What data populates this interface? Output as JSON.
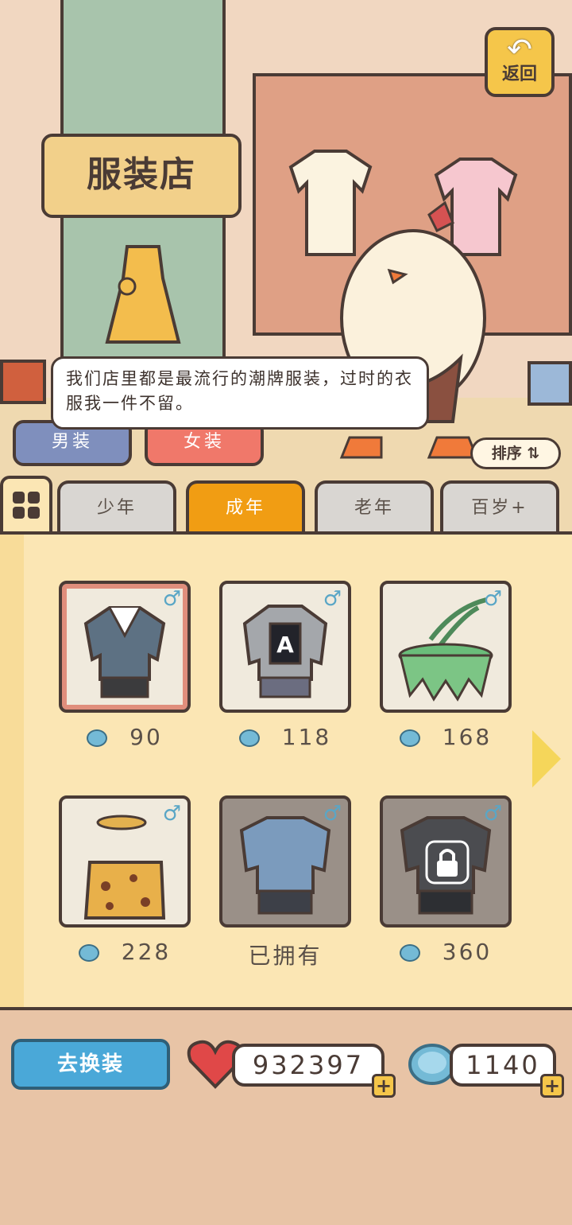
{
  "header": {
    "back_label": "返回",
    "shop_sign": "服装店",
    "speech": "我们店里都是最流行的潮牌服装，过时的衣服我一件不留。"
  },
  "gender_tabs": [
    {
      "label": "男装",
      "color": "#7f8fbd",
      "active": false
    },
    {
      "label": "女装",
      "color": "#f0786a",
      "active": false
    }
  ],
  "sort_label": "排序 ⇅",
  "age_tabs": [
    {
      "label": "少年",
      "active": false
    },
    {
      "label": "成年",
      "active": true
    },
    {
      "label": "老年",
      "active": false
    },
    {
      "label": "百岁+",
      "active": false
    }
  ],
  "items": [
    {
      "name": "blazer-outfit",
      "price": "90",
      "selected": true,
      "owned": false,
      "locked": false
    },
    {
      "name": "letter-a-jacket",
      "price": "118",
      "selected": false,
      "owned": false,
      "locked": false
    },
    {
      "name": "leaf-skirt",
      "price": "168",
      "selected": false,
      "owned": false,
      "locked": false
    },
    {
      "name": "leopard-outfit",
      "price": "228",
      "selected": false,
      "owned": false,
      "locked": false
    },
    {
      "name": "blue-shirt",
      "price": "已拥有",
      "selected": false,
      "owned": true,
      "locked": false
    },
    {
      "name": "black-shirt",
      "price": "360",
      "selected": false,
      "owned": true,
      "locked": true
    }
  ],
  "bottom": {
    "change_label": "去换装",
    "hearts": "932397",
    "coins": "1140"
  },
  "colors": {
    "accent": "#f19d13",
    "panel": "#fbe6b4",
    "coin": "#74bad6",
    "heart": "#e04848"
  }
}
